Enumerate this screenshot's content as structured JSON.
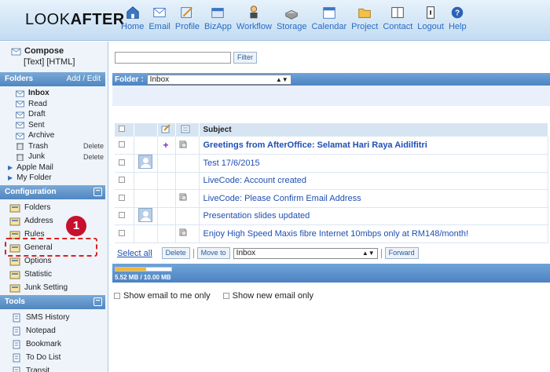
{
  "brand": {
    "light": "LOOK",
    "bold": "AFTER"
  },
  "nav": [
    {
      "label": "Home",
      "icon": "home-icon"
    },
    {
      "label": "Email",
      "icon": "email-icon"
    },
    {
      "label": "Profile",
      "icon": "profile-icon"
    },
    {
      "label": "BizApp",
      "icon": "bizapp-icon"
    },
    {
      "label": "Workflow",
      "icon": "workflow-icon"
    },
    {
      "label": "Storage",
      "icon": "storage-icon"
    },
    {
      "label": "Calendar",
      "icon": "calendar-icon"
    },
    {
      "label": "Project",
      "icon": "project-icon"
    },
    {
      "label": "Contact",
      "icon": "contact-icon"
    },
    {
      "label": "Logout",
      "icon": "logout-icon"
    },
    {
      "label": "Help",
      "icon": "help-icon"
    }
  ],
  "sidebar": {
    "compose_label": "Compose",
    "compose_formats": "[Text] [HTML]",
    "folders_heading": "Folders",
    "folders_action": "Add / Edit",
    "folders": [
      {
        "label": "Inbox",
        "active": true,
        "delete": ""
      },
      {
        "label": "Read",
        "delete": ""
      },
      {
        "label": "Draft",
        "delete": ""
      },
      {
        "label": "Sent",
        "delete": ""
      },
      {
        "label": "Archive",
        "delete": ""
      },
      {
        "label": "Trash",
        "delete": "Delete"
      },
      {
        "label": "Junk",
        "delete": "Delete"
      }
    ],
    "expandables": [
      "Apple Mail",
      "My Folder"
    ],
    "config_heading": "Configuration",
    "config_items": [
      "Folders",
      "Address",
      "Rules",
      "General",
      "Options",
      "Statistic",
      "Junk Setting"
    ],
    "tools_heading": "Tools",
    "tools_items": [
      "SMS History",
      "Notepad",
      "Bookmark",
      "To Do List",
      "Transit"
    ],
    "callout_number": "1"
  },
  "main": {
    "filter_button": "Filter",
    "filter_value": "",
    "folder_label": "Folder :",
    "folder_selected": "Inbox",
    "table_header_subject": "Subject",
    "messages": [
      {
        "subject": "Greetings from AfterOffice: Selamat Hari Raya Aidilfitri",
        "bold": true,
        "avatar": false,
        "flag": "+",
        "attachment": true
      },
      {
        "subject": "Test 17/6/2015",
        "bold": false,
        "avatar": true,
        "flag": "",
        "attachment": false
      },
      {
        "subject": "LiveCode: Account created",
        "bold": false,
        "avatar": false,
        "flag": "",
        "attachment": false
      },
      {
        "subject": "LiveCode: Please Confirm Email Address",
        "bold": false,
        "avatar": false,
        "flag": "",
        "attachment": true
      },
      {
        "subject": "Presentation slides updated",
        "bold": false,
        "avatar": true,
        "flag": "",
        "attachment": false
      },
      {
        "subject": "Enjoy High Speed Maxis fibre Internet 10mbps only at RM148/month!",
        "bold": false,
        "avatar": false,
        "flag": "",
        "attachment": true
      }
    ],
    "select_all": "Select all",
    "delete_button": "Delete",
    "move_to_button": "Move to",
    "move_target": "Inbox",
    "forward_button": "Forward",
    "storage_text": "5.52 MB / 10.00 MB",
    "storage_fraction": 0.552,
    "show_to_me": "Show email to me only",
    "show_new": "Show new email only"
  }
}
